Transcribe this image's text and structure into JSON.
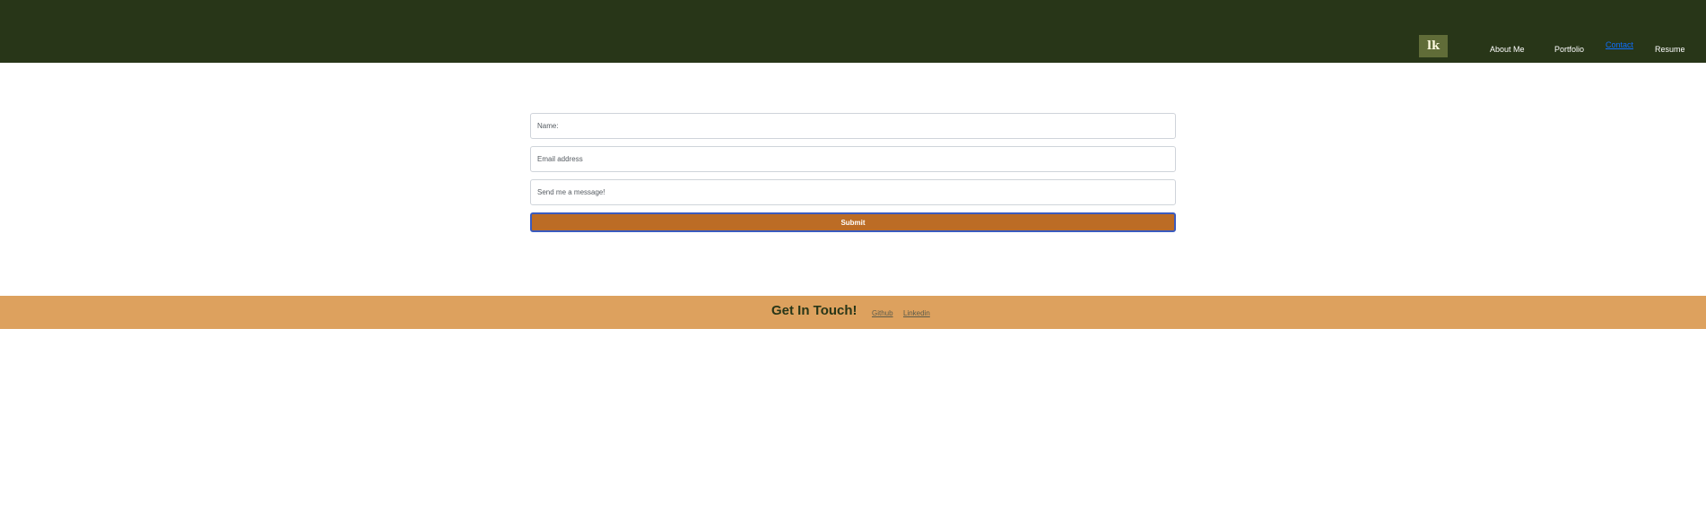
{
  "navbar": {
    "logo_text": "lk",
    "links": {
      "about": "About Me",
      "portfolio": "Portfolio",
      "contact": "Contact",
      "resume": "Resume"
    }
  },
  "contact_form": {
    "name_placeholder": "Name:",
    "email_placeholder": "Email address",
    "message_placeholder": "Send me a message!",
    "submit_label": "Submit"
  },
  "footer": {
    "title": "Get In Touch!",
    "github_label": "Github",
    "linkedin_label": "Linkedin"
  },
  "colors": {
    "navbar_bg": "#283618",
    "logo_bg": "#606c38",
    "submit_bg": "#bc6c25",
    "footer_bg": "#dda15e",
    "active_link": "#0d6efd"
  }
}
